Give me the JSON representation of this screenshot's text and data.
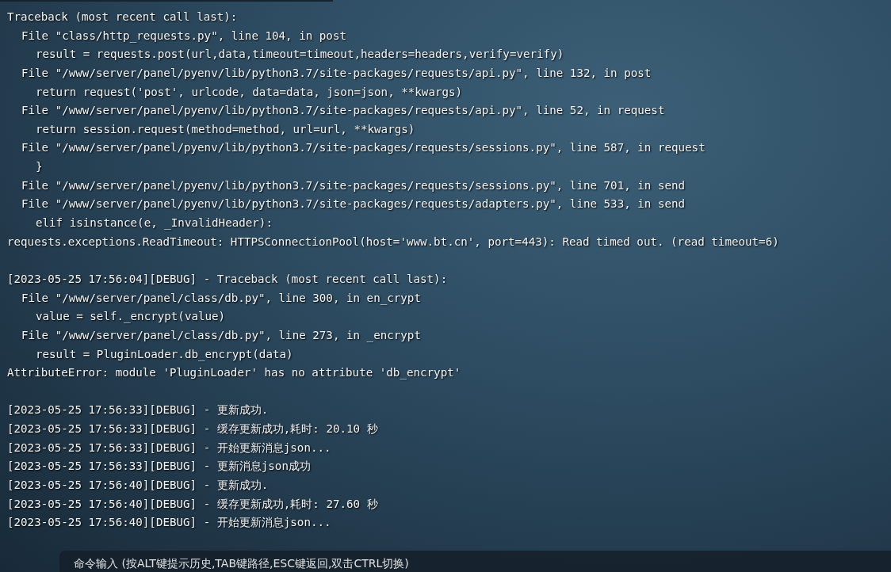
{
  "log": {
    "blocks": [
      {
        "lines": [
          {
            "text": "Traceback (most recent call last):",
            "children": [
              {
                "text": "File \"class/http_requests.py\", line 104, in post",
                "children": [
                  {
                    "text": "result = requests.post(url,data,timeout=timeout,headers=headers,verify=verify)"
                  }
                ]
              },
              {
                "text": "File \"/www/server/panel/pyenv/lib/python3.7/site-packages/requests/api.py\", line 132, in post",
                "children": [
                  {
                    "text": "return request('post', urlcode, data=data, json=json, **kwargs)"
                  }
                ]
              },
              {
                "text": "File \"/www/server/panel/pyenv/lib/python3.7/site-packages/requests/api.py\", line 52, in request",
                "children": [
                  {
                    "text": "return session.request(method=method, url=url, **kwargs)"
                  }
                ]
              },
              {
                "text": "File \"/www/server/panel/pyenv/lib/python3.7/site-packages/requests/sessions.py\", line 587, in request",
                "children": [
                  {
                    "text": "}"
                  }
                ]
              },
              {
                "text": "File \"/www/server/panel/pyenv/lib/python3.7/site-packages/requests/sessions.py\", line 701, in send"
              },
              {
                "text": "File \"/www/server/panel/pyenv/lib/python3.7/site-packages/requests/adapters.py\", line 533, in send",
                "children": [
                  {
                    "text": "elif isinstance(e, _InvalidHeader):"
                  }
                ]
              }
            ]
          },
          {
            "text": "requests.exceptions.ReadTimeout: HTTPSConnectionPool(host='www.bt.cn', port=443): Read timed out. (read timeout=6)"
          }
        ]
      },
      {
        "lines": [
          {
            "text": "[2023-05-25 17:56:04][DEBUG] - Traceback (most recent call last):",
            "children": [
              {
                "text": "File \"/www/server/panel/class/db.py\", line 300, in en_crypt",
                "children": [
                  {
                    "text": "value = self._encrypt(value)"
                  }
                ]
              },
              {
                "text": "File \"/www/server/panel/class/db.py\", line 273, in _encrypt",
                "children": [
                  {
                    "text": "result = PluginLoader.db_encrypt(data)"
                  }
                ]
              }
            ]
          },
          {
            "text": "AttributeError: module 'PluginLoader' has no attribute 'db_encrypt'"
          }
        ]
      },
      {
        "lines": [
          {
            "text": "[2023-05-25 17:56:33][DEBUG] - 更新成功."
          },
          {
            "text": "[2023-05-25 17:56:33][DEBUG] - 缓存更新成功,耗时: 20.10 秒"
          },
          {
            "text": "[2023-05-25 17:56:33][DEBUG] - 开始更新消息json..."
          },
          {
            "text": "[2023-05-25 17:56:33][DEBUG] - 更新消息json成功"
          },
          {
            "text": "[2023-05-25 17:56:40][DEBUG] - 更新成功."
          },
          {
            "text": "[2023-05-25 17:56:40][DEBUG] - 缓存更新成功,耗时: 27.60 秒"
          },
          {
            "text": "[2023-05-25 17:56:40][DEBUG] - 开始更新消息json..."
          }
        ]
      }
    ]
  },
  "command_input": {
    "placeholder": "命令输入 (按ALT键提示历史,TAB键路径,ESC键返回,双击CTRL切换)"
  }
}
